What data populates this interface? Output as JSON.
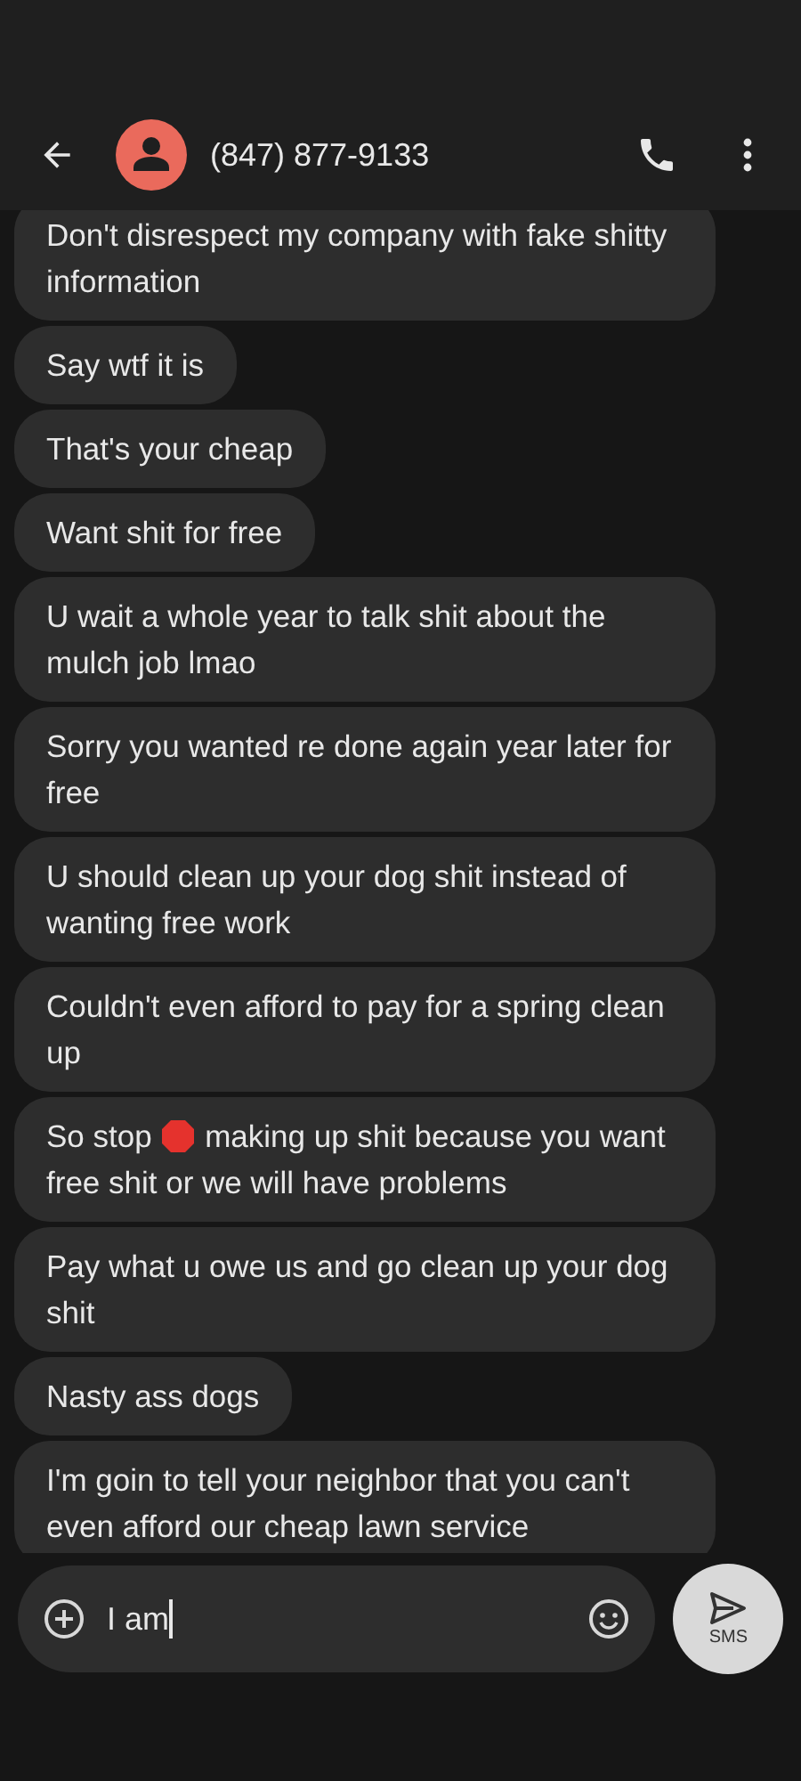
{
  "header": {
    "title": "(847) 877-9133"
  },
  "messages": [
    {
      "segments": [
        {
          "kind": "text",
          "text": "Don't disrespect my company with fake shitty information"
        }
      ]
    },
    {
      "segments": [
        {
          "kind": "text",
          "text": "Say wtf it is"
        }
      ]
    },
    {
      "segments": [
        {
          "kind": "text",
          "text": "That's your cheap"
        }
      ]
    },
    {
      "segments": [
        {
          "kind": "text",
          "text": "Want shit for free"
        }
      ]
    },
    {
      "segments": [
        {
          "kind": "text",
          "text": "U wait a whole year to talk shit about the mulch job lmao"
        }
      ]
    },
    {
      "segments": [
        {
          "kind": "text",
          "text": "Sorry you wanted re done again year later for free"
        }
      ]
    },
    {
      "segments": [
        {
          "kind": "text",
          "text": "U should clean up your dog shit instead of wanting free work"
        }
      ]
    },
    {
      "segments": [
        {
          "kind": "text",
          "text": "Couldn't even afford to pay for a spring clean up"
        }
      ]
    },
    {
      "segments": [
        {
          "kind": "text",
          "text": "So stop "
        },
        {
          "kind": "stop-emoji"
        },
        {
          "kind": "text",
          "text": " making up shit because you want free shit or we will have problems"
        }
      ]
    },
    {
      "segments": [
        {
          "kind": "text",
          "text": "Pay what u owe us and go clean up your dog shit"
        }
      ]
    },
    {
      "segments": [
        {
          "kind": "text",
          "text": "Nasty ass dogs"
        }
      ]
    },
    {
      "segments": [
        {
          "kind": "text",
          "text": "I'm goin to tell your neighbor that you can't even afford our cheap lawn service"
        }
      ]
    }
  ],
  "composer": {
    "value": "I am",
    "send_label": "SMS"
  }
}
